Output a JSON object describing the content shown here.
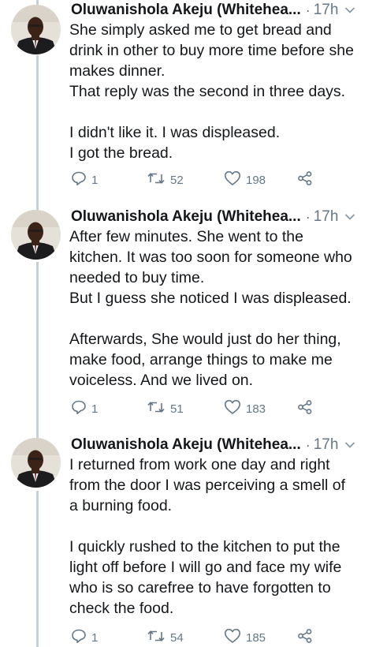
{
  "tweets": [
    {
      "author": "Oluwanishola Akeju (Whitehea...",
      "separator": "·",
      "time": "17h",
      "text": "She simply asked me to get bread and\ndrink in other to buy more time before she\nmakes dinner.\nThat reply was the second in three days.\n\nI didn't like it. I was displeased.\nI got the bread.",
      "replies": "1",
      "retweets": "52",
      "likes": "198"
    },
    {
      "author": "Oluwanishola Akeju (Whitehea...",
      "separator": "·",
      "time": "17h",
      "text": "After few minutes. She went to the\nkitchen. It was too soon for someone who\nneeded to buy time.\nBut I guess she noticed I was displeased.\n\nAfterwards, She would just do her thing,\nmake food, arrange things to make me\nvoiceless. And we lived on.",
      "replies": "1",
      "retweets": "51",
      "likes": "183"
    },
    {
      "author": "Oluwanishola Akeju (Whitehea...",
      "separator": "·",
      "time": "17h",
      "text": "I returned from work one day and right\nfrom the door I was perceiving a smell of\na burning food.\n\nI quickly rushed to the kitchen to put the\nlight off before I will go and face my wife\nwho is so carefree to have forgotten to\ncheck the food.",
      "replies": "1",
      "retweets": "54",
      "likes": "185"
    }
  ],
  "icons": {
    "reply": "reply-icon",
    "retweet": "retweet-icon",
    "like": "heart-icon",
    "share": "share-icon",
    "caret": "chevron-down-icon"
  },
  "colors": {
    "text": "#14171a",
    "muted": "#657786",
    "thread_line": "#c4cfd6"
  }
}
